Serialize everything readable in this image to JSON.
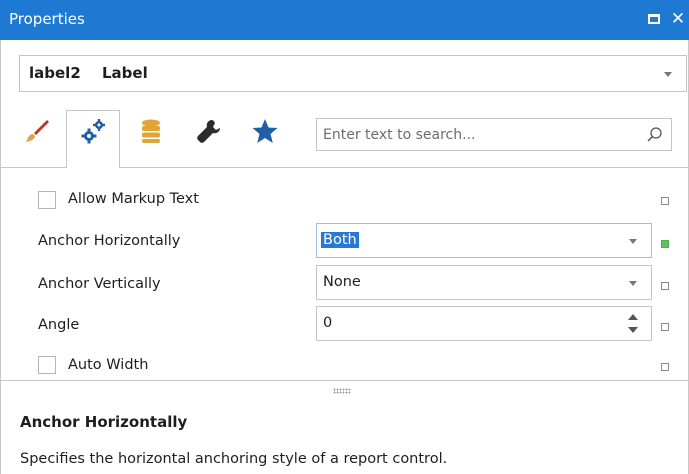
{
  "window": {
    "title": "Properties"
  },
  "selector": {
    "name": "label2",
    "type": "Label"
  },
  "tabs": [
    {
      "icon": "brush-icon",
      "color": "#b5371f"
    },
    {
      "icon": "gears-icon",
      "color": "#1f5fa8",
      "active": true
    },
    {
      "icon": "database-icon",
      "color": "#e0a437"
    },
    {
      "icon": "wrench-icon",
      "color": "#2b2b2b"
    },
    {
      "icon": "star-icon",
      "color": "#1f5fa8"
    }
  ],
  "search": {
    "placeholder": "Enter text to search..."
  },
  "properties": [
    {
      "label": "Allow Markup Text",
      "kind": "checkbox"
    },
    {
      "label": "Anchor Horizontally",
      "kind": "dropdown",
      "value": "Both",
      "value_selected": true,
      "modified": true
    },
    {
      "label": "Anchor Vertically",
      "kind": "dropdown",
      "value": "None"
    },
    {
      "label": "Angle",
      "kind": "spin",
      "value": "0"
    },
    {
      "label": "Auto Width",
      "kind": "checkbox"
    }
  ],
  "description": {
    "title": "Anchor Horizontally",
    "text": "Specifies the horizontal anchoring style of a report control."
  },
  "colors": {
    "titlebar": "#1e79d2",
    "selection": "#2a78d6",
    "modified_marker": "#5ec15e"
  }
}
